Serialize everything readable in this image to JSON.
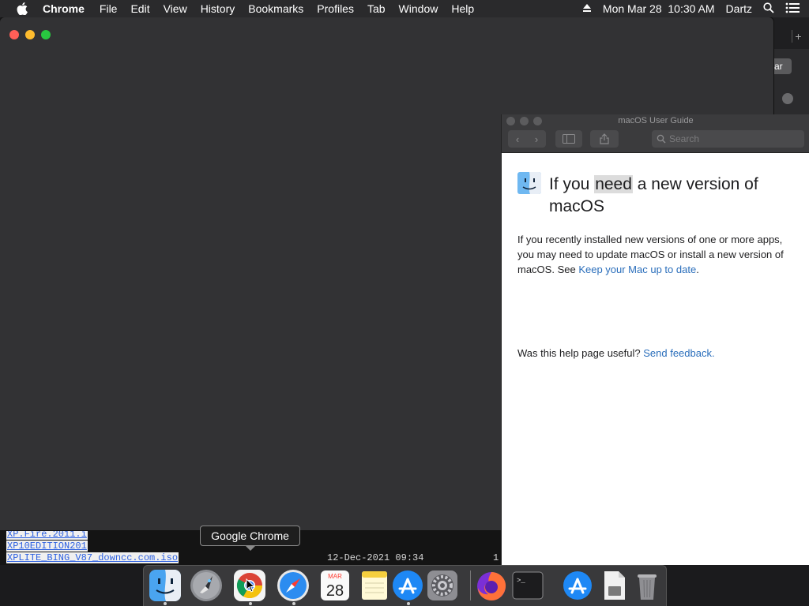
{
  "menubar": {
    "app_name": "Chrome",
    "items": [
      "File",
      "Edit",
      "View",
      "History",
      "Bookmarks",
      "Profiles",
      "Tab",
      "Window",
      "Help"
    ],
    "datetime": "Mon Mar 28  10:30 AM",
    "user": "Dartz"
  },
  "background_listing": {
    "rows": [
      {
        "name": "XP.Fire.2011.i",
        "date": ""
      },
      {
        "name": "XP10EDITION201",
        "date": ""
      },
      {
        "name": "XPLITE_BING_V87_downcc.com.iso",
        "date": "12-Dec-2021 09:34"
      }
    ],
    "trailing_char": "1"
  },
  "bg_right_window": {
    "button_label": "ar"
  },
  "help_viewer": {
    "window_title": "macOS User Guide",
    "search_placeholder": "Search",
    "heading_before": "If you ",
    "heading_highlight": "need",
    "heading_after": " a new version of macOS",
    "body_text": "If you recently installed new versions of one or more apps, you may need to update macOS or install a new version of macOS. See ",
    "body_link": "Keep your Mac up to date",
    "body_end": ".",
    "feedback_question": "Was this help page useful? ",
    "feedback_link": "Send feedback."
  },
  "tooltip": {
    "text": "Google Chrome"
  },
  "dock": {
    "items": [
      "finder-icon",
      "launchpad-icon",
      "chrome-icon",
      "safari-icon",
      "calendar-icon",
      "notes-icon",
      "app-store-icon",
      "system-preferences-icon",
      "firefox-icon",
      "terminal-icon",
      "app-store-downloads-icon",
      "document-icon",
      "trash-icon"
    ],
    "calendar_month": "MAR",
    "calendar_day": "28"
  },
  "colors": {
    "link": "#2a6ebb",
    "close": "#ff5f57",
    "minimize": "#febc2e",
    "zoom": "#28c840"
  }
}
